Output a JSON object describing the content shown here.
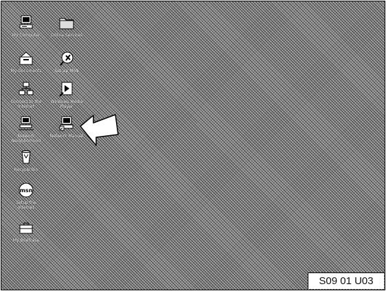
{
  "desktop": {
    "background_color": "#8c8c8c",
    "icons": [
      {
        "name": "my-computer-desktop-icon",
        "glyph": "computer-icon",
        "label": "My Computer"
      },
      {
        "name": "online-services-desktop-icon",
        "glyph": "folder-icon",
        "label": "Online Services"
      },
      {
        "name": "my-documents-desktop-icon",
        "glyph": "documents-folder-icon",
        "label": "My Documents"
      },
      {
        "name": "setup-msn-desktop-icon",
        "glyph": "msn-butterfly-icon",
        "label": "Set Up MSN"
      },
      {
        "name": "connect-internet-desktop-icon",
        "glyph": "network-computers-icon",
        "label": "Connect to the Internet"
      },
      {
        "name": "windows-media-player-desktop-icon",
        "glyph": "media-player-icon",
        "label": "Windows Media Player"
      },
      {
        "name": "network-neighborhood-desktop-icon",
        "glyph": "network-neighborhood-icon",
        "label": "Network Neighborhood"
      },
      {
        "name": "network-manual-desktop-icon",
        "glyph": "network-shortcut-icon",
        "label": "Network Manual"
      },
      {
        "name": "recycle-bin-desktop-icon",
        "glyph": "recycle-bin-icon",
        "label": "Recycle Bin"
      },
      {
        "name": "msn-desktop-icon",
        "glyph": "msn-logo-icon",
        "label": "Setup the Internet"
      },
      {
        "name": "my-briefcase-desktop-icon",
        "glyph": "briefcase-icon",
        "label": "My Briefcase"
      }
    ]
  },
  "pointer": {
    "glyph": "pointing-arrow-icon"
  },
  "figure_stamp": "S09 01 U03"
}
